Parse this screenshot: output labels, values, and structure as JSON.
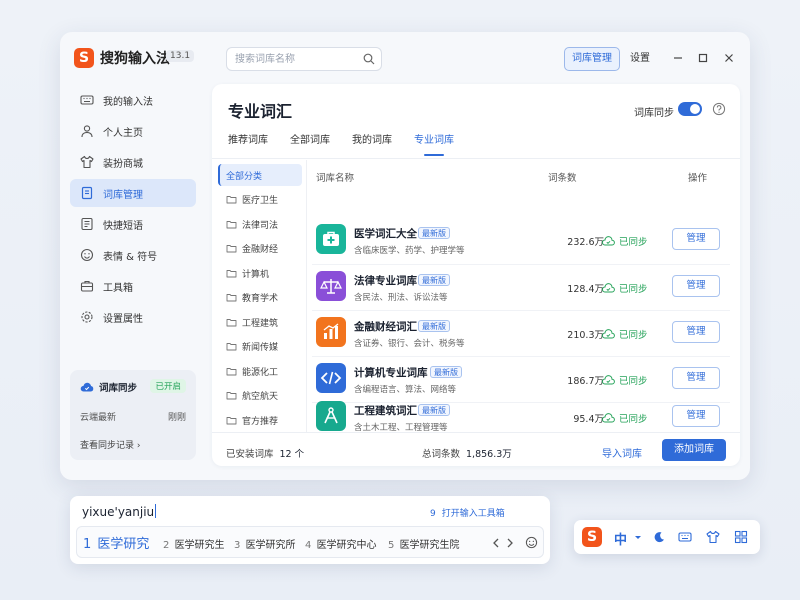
{
  "app": {
    "logo_letter": "S",
    "name": "搜狗输入法",
    "version": "13.1",
    "search_placeholder": "搜索词库名称",
    "top_primary_button": "词库管理",
    "top_settings_button": "设置"
  },
  "sidebar": {
    "items": [
      {
        "label": "我的输入法",
        "icon": "keyboard-icon"
      },
      {
        "label": "个人主页",
        "icon": "user-icon"
      },
      {
        "label": "装扮商城",
        "icon": "shirt-icon"
      },
      {
        "label": "词库管理",
        "icon": "book-icon",
        "active": true
      },
      {
        "label": "快捷短语",
        "icon": "note-icon"
      },
      {
        "label": "表情 & 符号",
        "icon": "smile-icon"
      },
      {
        "label": "工具箱",
        "icon": "toolbox-icon"
      },
      {
        "label": "设置属性",
        "icon": "gear-icon"
      }
    ],
    "sync_card": {
      "title": "词库同步",
      "badge": "已开启",
      "row_label": "云端最新",
      "row_value": "刚刚",
      "link": "查看同步记录 ›"
    }
  },
  "panel": {
    "title": "专业词汇",
    "sync_label": "词库同步",
    "sync_on": true,
    "tabs": [
      {
        "label": "推荐词库"
      },
      {
        "label": "全部词库"
      },
      {
        "label": "我的词库"
      },
      {
        "label": "专业词库",
        "active": true
      }
    ],
    "categories": [
      {
        "label": "全部分类",
        "active": true
      },
      {
        "label": "医疗卫生"
      },
      {
        "label": "法律司法"
      },
      {
        "label": "金融财经"
      },
      {
        "label": "计算机"
      },
      {
        "label": "教育学术"
      },
      {
        "label": "工程建筑"
      },
      {
        "label": "新闻传媒"
      },
      {
        "label": "能源化工"
      },
      {
        "label": "航空航天"
      },
      {
        "label": "官方推荐"
      }
    ],
    "table": {
      "headers": {
        "name": "词库名称",
        "count": "词条数",
        "action": "操作"
      },
      "rows": [
        {
          "name": "医学词汇大全",
          "badge": "最新版",
          "desc": "含临床医学、药学、护理学等",
          "count": "232.6万",
          "status": "已同步",
          "action": "管理",
          "icon": "medkit-icon",
          "color": "#19b59a"
        },
        {
          "name": "法律专业词库",
          "badge": "最新版",
          "desc": "含民法、刑法、诉讼法等",
          "count": "128.4万",
          "status": "已同步",
          "action": "管理",
          "icon": "scale-icon",
          "color": "#8a4fd8"
        },
        {
          "name": "金融财经词汇",
          "badge": "最新版",
          "desc": "含证券、银行、会计、税务等",
          "count": "210.3万",
          "status": "已同步",
          "action": "管理",
          "icon": "bar-chart-icon",
          "color": "#f2741e"
        },
        {
          "name": "计算机专业词库",
          "badge": "最新版",
          "desc": "含编程语言、算法、网络等",
          "count": "186.7万",
          "status": "已同步",
          "action": "管理",
          "icon": "code-icon",
          "color": "#2f6bd8"
        },
        {
          "name": "工程建筑词汇",
          "badge": "最新版",
          "desc": "含土木工程、工程管理等",
          "count": "95.4万",
          "status": "已同步",
          "action": "管理",
          "icon": "compass-icon",
          "color": "#17a98e"
        }
      ]
    },
    "footer": {
      "installed_label": "已安装词库",
      "installed_value": "12 个",
      "total_label": "总词条数",
      "total_value": "1,856.3万",
      "import_button": "导入词库",
      "add_button": "添加词库"
    }
  },
  "ime": {
    "input_text": "yixue'yanjiu",
    "hint_number": "9",
    "hint_text": "打开输入工具箱",
    "candidates": [
      {
        "n": "1",
        "text": "医学研究"
      },
      {
        "n": "2",
        "text": "医学研究生"
      },
      {
        "n": "3",
        "text": "医学研究所"
      },
      {
        "n": "4",
        "text": "医学研究中心"
      },
      {
        "n": "5",
        "text": "医学研究生院"
      }
    ]
  },
  "statusbar": {
    "logo_letter": "S",
    "lang": "中",
    "icons": [
      "chevron-down-icon",
      "moon-icon",
      "keyboard-icon",
      "shirt-icon",
      "grid-icon"
    ]
  },
  "colors": {
    "accent": "#2f6bd8",
    "brand": "#f2541b",
    "success": "#26a35a"
  }
}
